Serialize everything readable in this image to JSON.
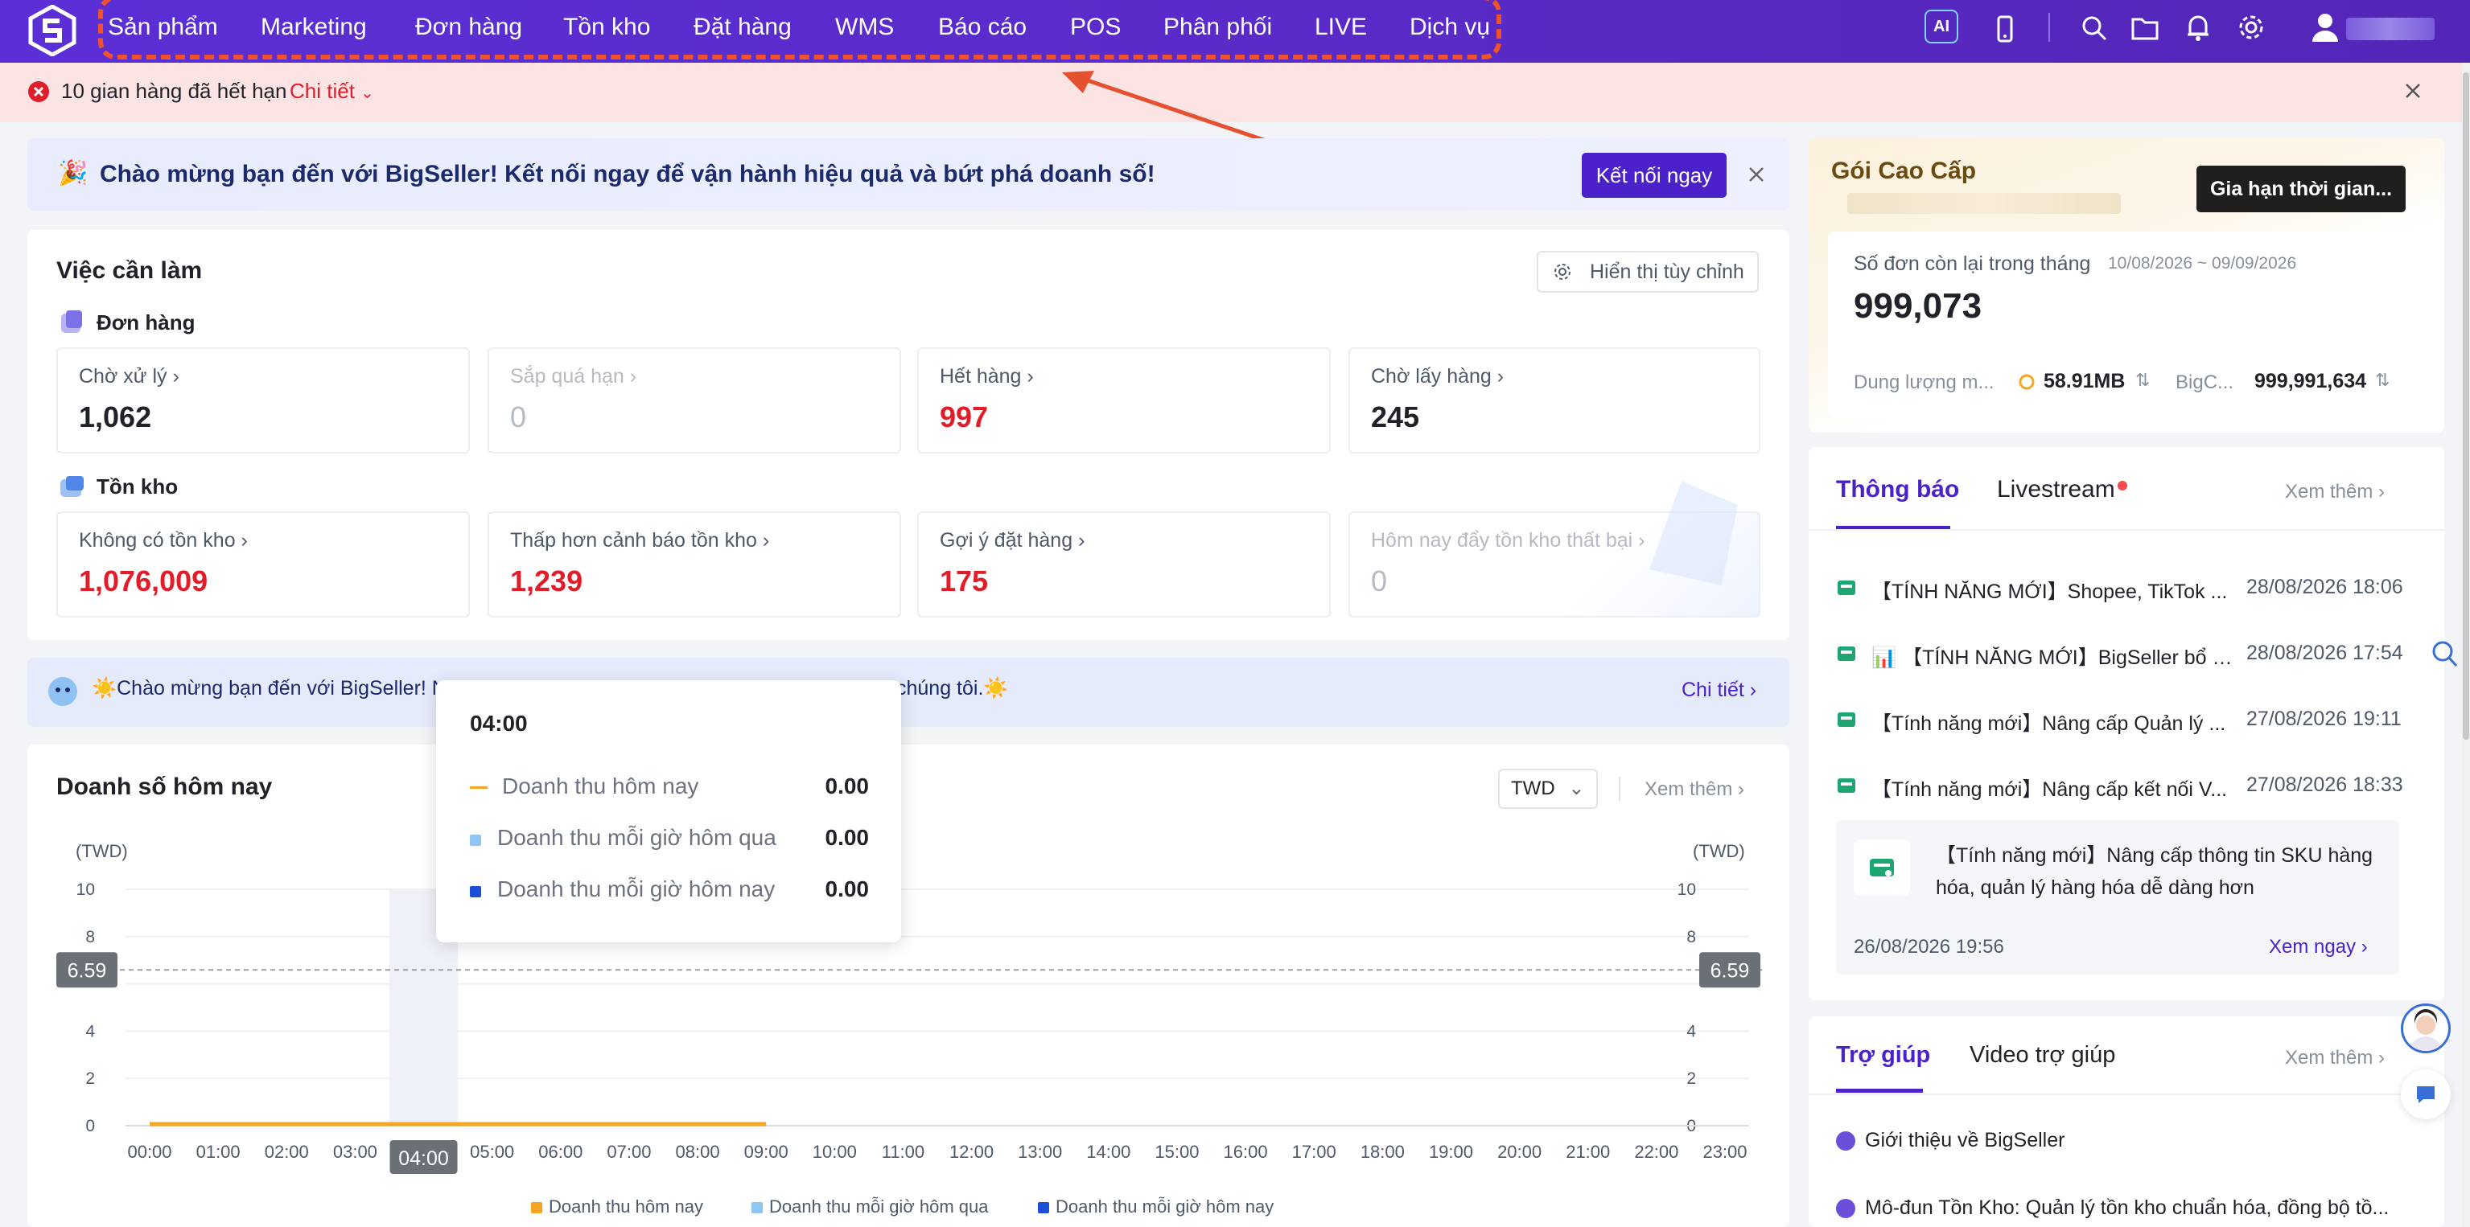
{
  "nav": {
    "items": [
      "Sản phẩm",
      "Marketing",
      "Đơn hàng",
      "Tồn kho",
      "Đặt hàng",
      "WMS",
      "Báo cáo",
      "POS",
      "Phân phối",
      "LIVE",
      "Dịch vụ"
    ],
    "ai_label": "AI"
  },
  "alert": {
    "text": "10 gian hàng đã hết hạn",
    "detail_link": "Chi tiết"
  },
  "welcome": {
    "text": "Chào mừng bạn đến với BigSeller! Kết nối ngay để vận hành hiệu quả và bứt phá doanh số!",
    "button": "Kết nối ngay"
  },
  "todo": {
    "title": "Việc cần làm",
    "customize_button": "Hiển thị tùy chỉnh",
    "orders_title": "Đơn hàng",
    "orders": [
      {
        "label": "Chờ xử lý",
        "value": "1,062"
      },
      {
        "label": "Sắp quá hạn",
        "value": "0"
      },
      {
        "label": "Hết hàng",
        "value": "997"
      },
      {
        "label": "Chờ lấy hàng",
        "value": "245"
      }
    ],
    "inventory_title": "Tồn kho",
    "inventory": [
      {
        "label": "Không có tồn kho",
        "value": "1,076,009"
      },
      {
        "label": "Thấp hơn cảnh báo tồn kho",
        "value": "1,239"
      },
      {
        "label": "Gợi ý đặt hàng",
        "value": "175"
      },
      {
        "label": "Hôm nay đẩy tồn kho thất bại",
        "value": "0"
      }
    ]
  },
  "banner2": {
    "text_left": "☀️Chào mừng bạn đến với BigSeller! N",
    "text_right": "chúng tôi.☀️",
    "link": "Chi tiết"
  },
  "sales": {
    "title": "Doanh số hôm nay",
    "currency": "TWD",
    "more": "Xem thêm"
  },
  "tooltip": {
    "time": "04:00",
    "rows": [
      {
        "label": "Doanh thu hôm nay",
        "value": "0.00"
      },
      {
        "label": "Doanh thu mỗi giờ hôm qua",
        "value": "0.00"
      },
      {
        "label": "Doanh thu mỗi giờ hôm nay",
        "value": "0.00"
      }
    ]
  },
  "chart_data": {
    "type": "line",
    "title": "",
    "ylabel_left": "(TWD)",
    "ylabel_right": "(TWD)",
    "ylim": [
      0,
      10
    ],
    "y_ticks": [
      "0",
      "2",
      "4",
      "",
      "8",
      "10"
    ],
    "reference_line": {
      "value": 6.59,
      "label": "6.59"
    },
    "x": [
      "00:00",
      "01:00",
      "02:00",
      "03:00",
      "04:00",
      "05:00",
      "06:00",
      "07:00",
      "08:00",
      "09:00",
      "10:00",
      "11:00",
      "12:00",
      "13:00",
      "14:00",
      "15:00",
      "16:00",
      "17:00",
      "18:00",
      "19:00",
      "20:00",
      "21:00",
      "22:00",
      "23:00"
    ],
    "highlight_x": "04:00",
    "series": [
      {
        "name": "Doanh thu hôm nay",
        "color": "#f5a623",
        "values": [
          0,
          0,
          0,
          0,
          0,
          0,
          0,
          0,
          0,
          0
        ]
      },
      {
        "name": "Doanh thu mỗi giờ hôm qua",
        "color": "#8ec5f5",
        "values": []
      },
      {
        "name": "Doanh thu mỗi giờ hôm nay",
        "color": "#1d4ed8",
        "values": []
      }
    ],
    "grid": true
  },
  "premium": {
    "title": "Gói Cao Cấp",
    "extend_button": "Gia hạn thời gian...",
    "orders_left_label": "Số đơn còn lại trong tháng",
    "period": "10/08/2026 ~ 09/09/2026",
    "orders_left": "999,073",
    "storage_label": "Dung lượng m...",
    "storage_value": "58.91MB",
    "bigc_label": "BigC...",
    "bigc_value": "999,991,634"
  },
  "news": {
    "tabs": [
      "Thông báo",
      "Livestream"
    ],
    "more": "Xem thêm",
    "items": [
      {
        "title": "【TÍNH NĂNG MỚI】Shopee, TikTok ...",
        "date": "28/08/2026 18:06"
      },
      {
        "title": "📊 【TÍNH NĂNG MỚI】BigSeller bổ su...",
        "date": "28/08/2026 17:54"
      },
      {
        "title": "【Tính năng mới】Nâng cấp Quản lý ...",
        "date": "27/08/2026 19:11"
      },
      {
        "title": "【Tính năng mới】Nâng cấp kết nối V...",
        "date": "27/08/2026 18:33"
      }
    ],
    "featured": {
      "title": "【Tính năng mới】Nâng cấp thông tin SKU hàng hóa, quản lý hàng hóa dễ dàng hơn",
      "date": "26/08/2026 19:56",
      "link": "Xem ngay"
    }
  },
  "help": {
    "tabs": [
      "Trợ giúp",
      "Video trợ giúp"
    ],
    "more": "Xem thêm",
    "items": [
      "Giới thiệu về BigSeller",
      "Mô-đun Tồn Kho: Quản lý tồn kho chuẩn hóa, đồng bộ tồ..."
    ]
  },
  "colors": {
    "brand": "#5b2fd6",
    "danger": "#e11d2a",
    "accent": "#f0532a"
  }
}
